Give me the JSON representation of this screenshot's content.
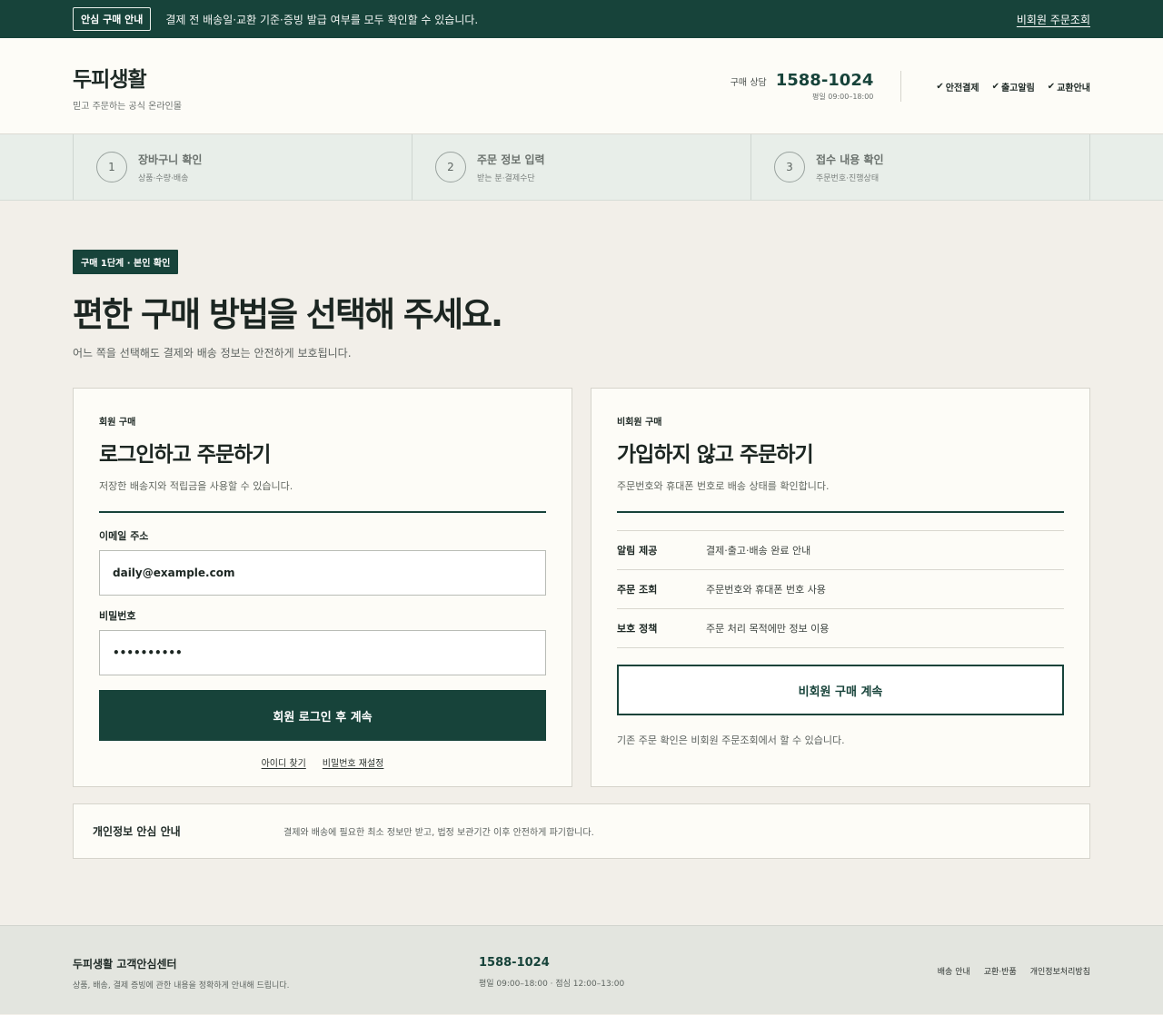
{
  "topbar": {
    "badge": "안심 구매 안내",
    "message": "결제 전 배송일·교환 기준·증빙 발급 여부를 모두 확인할 수 있습니다.",
    "link": "비회원 주문조회"
  },
  "header": {
    "brand": "두피생활",
    "tagline": "믿고 주문하는 공식 온라인몰",
    "phone_label": "구매 상담",
    "phone": "1588-1024",
    "hours": "평일 09:00–18:00",
    "checks": [
      {
        "icon": "check-icon",
        "label": "안전결제"
      },
      {
        "icon": "check-icon",
        "label": "출고알림"
      },
      {
        "icon": "check-icon",
        "label": "교환안내"
      }
    ]
  },
  "steps": [
    {
      "num": "1",
      "title": "장바구니 확인",
      "desc": "상품·수량·배송"
    },
    {
      "num": "2",
      "title": "주문 정보 입력",
      "desc": "받는 분·결제수단"
    },
    {
      "num": "3",
      "title": "접수 내용 확인",
      "desc": "주문번호·진행상태"
    }
  ],
  "main": {
    "badge": "구매 1단계 · 본인 확인",
    "title": "편한 구매 방법을 선택해 주세요.",
    "subtitle": "어느 쪽을 선택해도 결제와 배송 정보는 안전하게 보호됩니다."
  },
  "member": {
    "kicker": "회원 구매",
    "title": "로그인하고 주문하기",
    "desc": "저장한 배송지와 적립금을 사용할 수 있습니다.",
    "email_label": "이메일 주소",
    "email_value": "daily@example.com",
    "password_label": "비밀번호",
    "password_value": "••••••••••",
    "submit": "회원 로그인 후 계속",
    "find_id": "아이디 찾기",
    "reset_pw": "비밀번호 재설정"
  },
  "guest": {
    "kicker": "비회원 구매",
    "title": "가입하지 않고 주문하기",
    "desc": "주문번호와 휴대폰 번호로 배송 상태를 확인합니다.",
    "rows": [
      {
        "key": "알림 제공",
        "value": "결제·출고·배송 완료 안내"
      },
      {
        "key": "주문 조회",
        "value": "주문번호와 휴대폰 번호 사용"
      },
      {
        "key": "보호 정책",
        "value": "주문 처리 목적에만 정보 이용"
      }
    ],
    "button": "비회원 구매 계속",
    "note": "기존 주문 확인은 비회원 주문조회에서 할 수 있습니다."
  },
  "privacy": {
    "title": "개인정보 안심 안내",
    "text": "결제와 배송에 필요한 최소 정보만 받고, 법정 보관기간 이후 안전하게 파기합니다."
  },
  "footer": {
    "title": "두피생활 고객안심센터",
    "desc": "상품, 배송, 결제 증빙에 관한 내용을 정확하게 안내해 드립니다.",
    "phone": "1588-1024",
    "hours": "평일 09:00–18:00 · 점심 12:00–13:00",
    "links": [
      "배송 안내",
      "교환·반품",
      "개인정보처리방침"
    ]
  },
  "colors": {
    "brand_green": "#17433a",
    "page_bg": "#f2efe9",
    "card_bg": "#fdfcf7"
  }
}
